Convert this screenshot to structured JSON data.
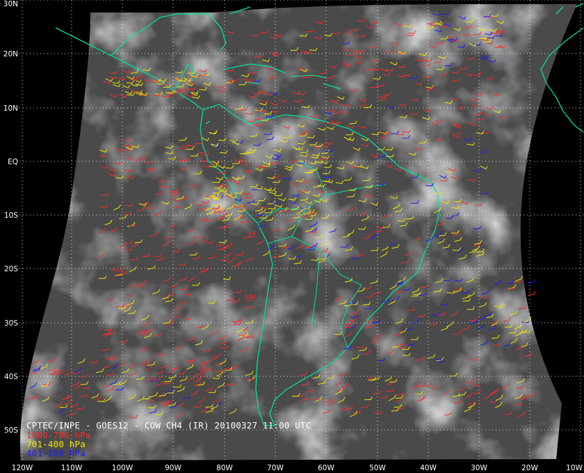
{
  "product": {
    "title": "CPTEC/INPE - GOES12 - COW CH4 (IR) 20100327 11:00 UTC"
  },
  "legend": [
    {
      "label": "1000-700 hPa",
      "color": "#ff2a2a"
    },
    {
      "label": "701-400 hPa",
      "color": "#f2e800"
    },
    {
      "label": "401-100 hPa",
      "color": "#1a1aff"
    }
  ],
  "coastline_color": "#00e0a0",
  "lat_labels": [
    "30N",
    "20N",
    "10N",
    "EQ",
    "10S",
    "20S",
    "30S",
    "40S",
    "50S"
  ],
  "lon_labels": [
    "120W",
    "110W",
    "100W",
    "90W",
    "80W",
    "70W",
    "60W",
    "50W",
    "40W",
    "30W",
    "20W",
    "10W"
  ]
}
